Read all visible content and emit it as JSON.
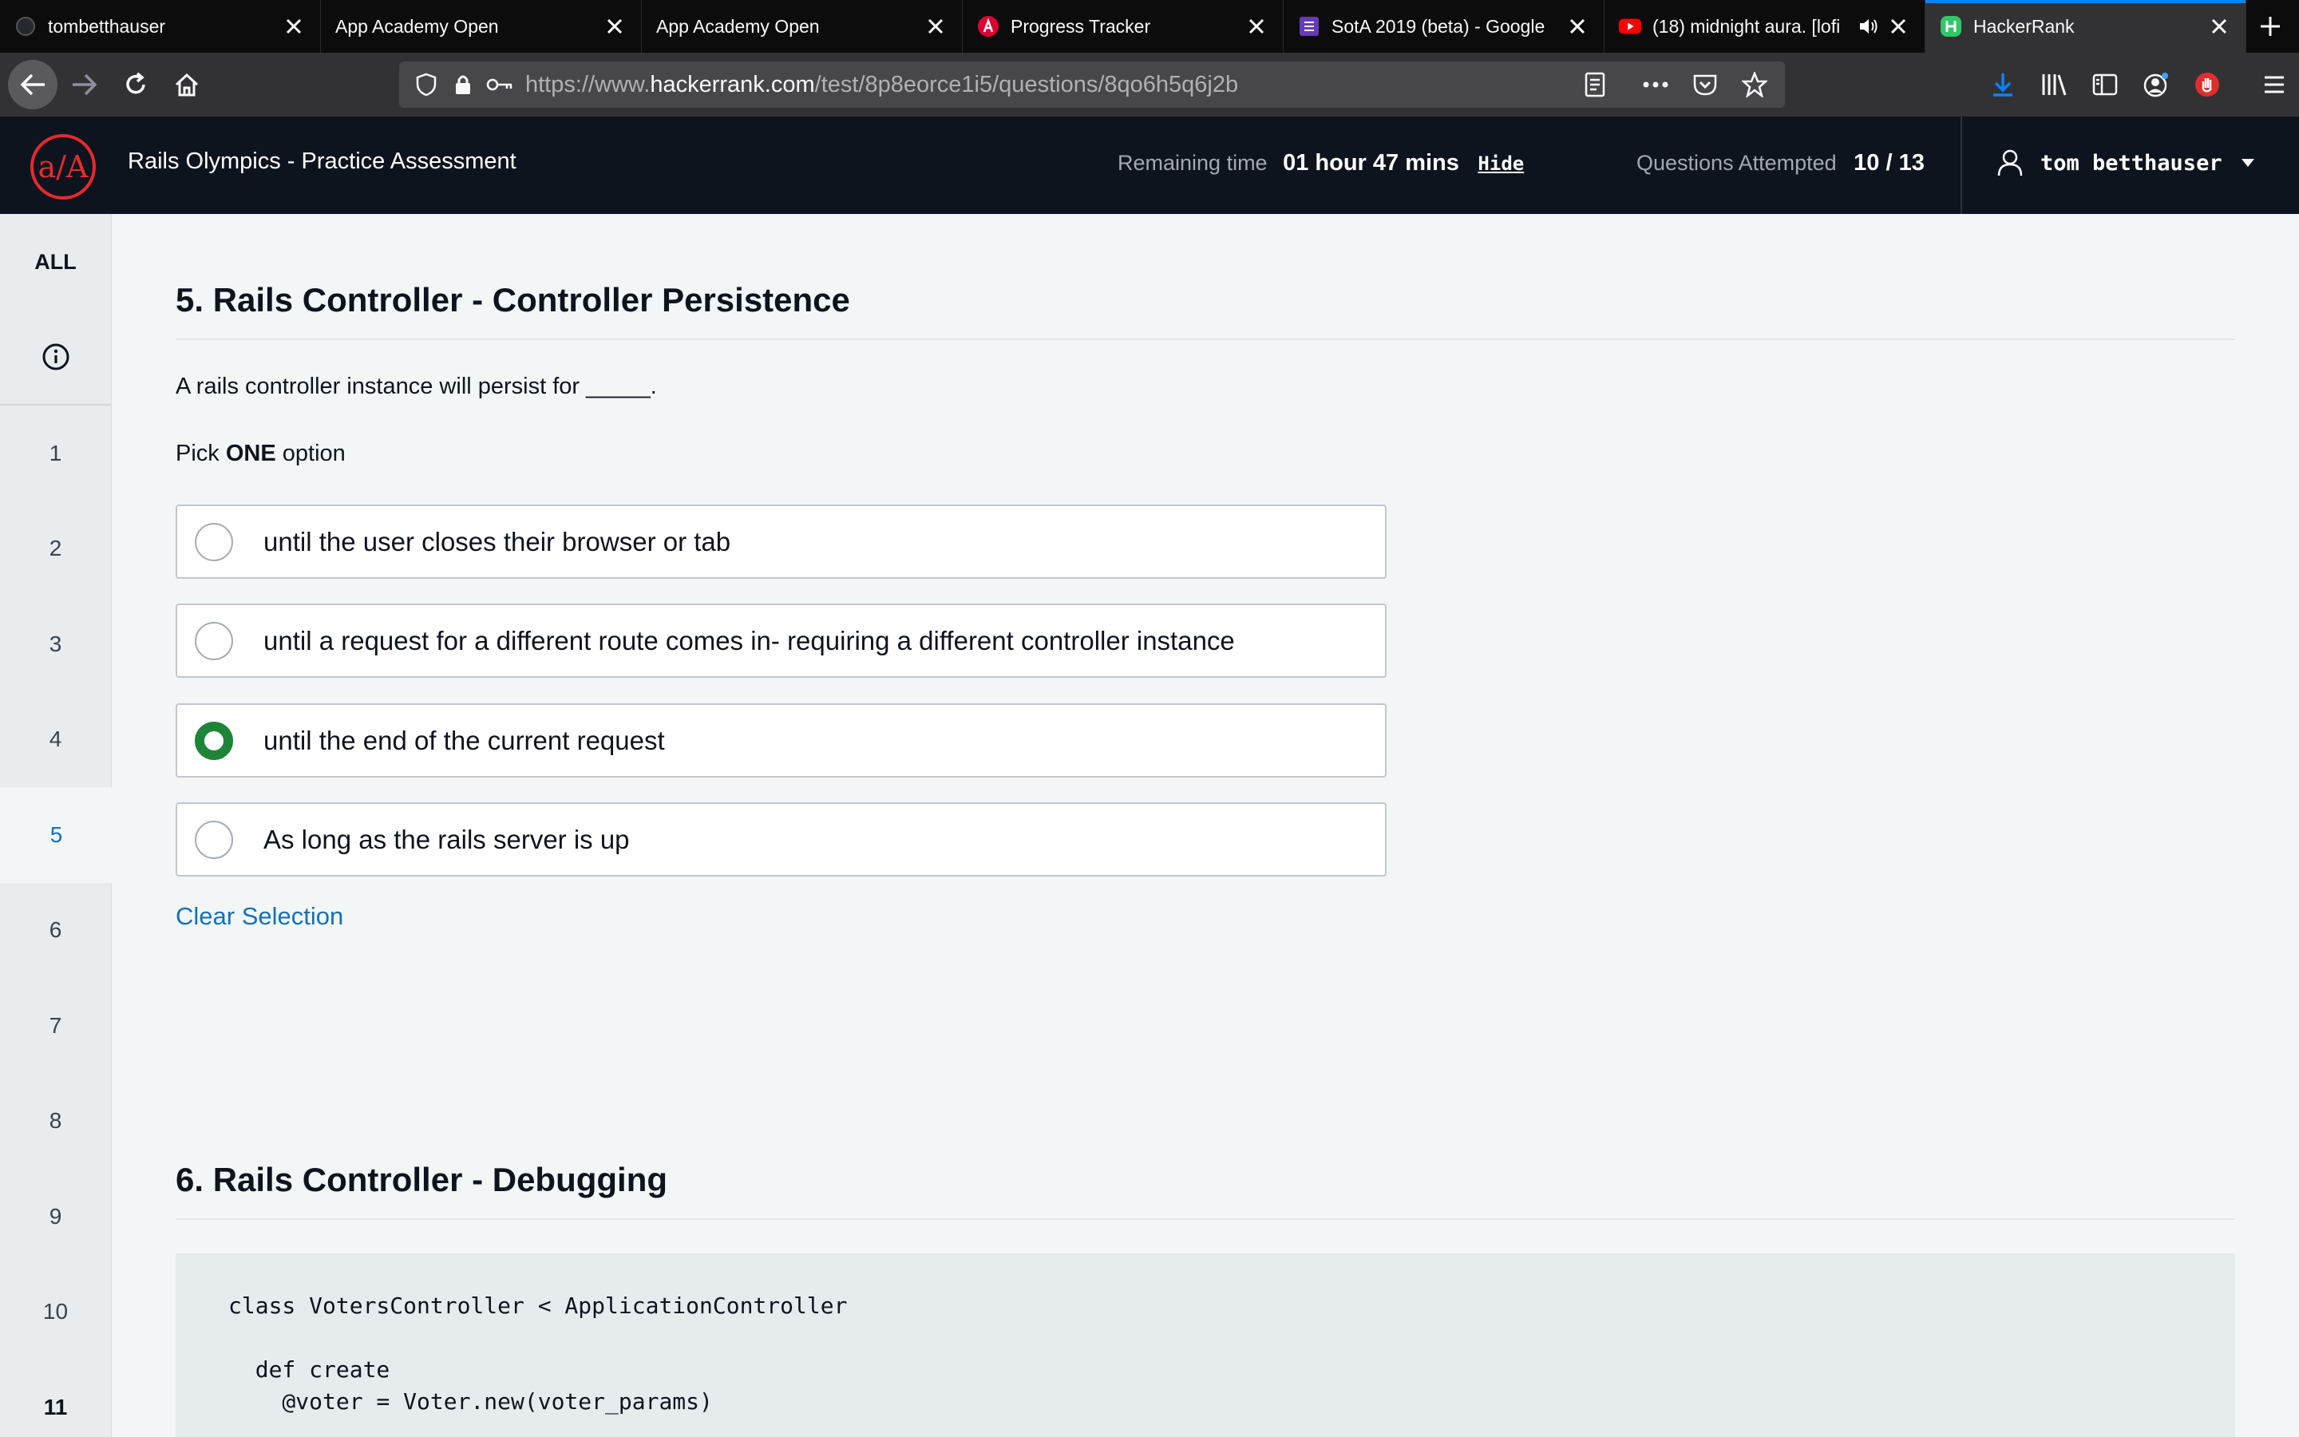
{
  "browser": {
    "tabs": [
      {
        "title": "tombetthauser",
        "icon": "github-icon"
      },
      {
        "title": "App Academy Open",
        "icon": "none"
      },
      {
        "title": "App Academy Open",
        "icon": "none"
      },
      {
        "title": "Progress Tracker",
        "icon": "angular-icon"
      },
      {
        "title": "SotA 2019 (beta) - Google",
        "icon": "google-forms-icon"
      },
      {
        "title": "(18) midnight aura. [lofi",
        "icon": "youtube-icon"
      },
      {
        "title": "HackerRank",
        "icon": "hackerrank-icon"
      }
    ],
    "url_prefix": "https://www.",
    "url_host": "hackerrank.com",
    "url_path": "/test/8p8eorce1i5/questions/8qo6h5q6j2b"
  },
  "header": {
    "test_name": "Rails Olympics - Practice Assessment",
    "remaining_label": "Remaining time",
    "remaining_value": "01 hour 47 mins",
    "hide_label": "Hide",
    "attempted_label": "Questions Attempted",
    "attempted_value": "10 / 13",
    "user_name": "tom betthauser"
  },
  "sidebar": {
    "all_label": "ALL",
    "items": [
      "1",
      "2",
      "3",
      "4",
      "5",
      "6",
      "7",
      "8",
      "9",
      "10",
      "11"
    ]
  },
  "question5": {
    "title": "5. Rails Controller - Controller Persistence",
    "text": "A rails controller instance will persist for _____.",
    "pick_prefix": "Pick",
    "pick_bold": "ONE",
    "pick_suffix": "option",
    "options": [
      "until the user closes their browser or tab",
      "until a request for a different route comes in- requiring a different controller instance",
      "until the end of the current request",
      "As long as the rails server is up"
    ],
    "selected_index": 2,
    "clear_label": "Clear Selection"
  },
  "question6": {
    "title": "6. Rails Controller - Debugging",
    "code": "class VotersController < ApplicationController\n\n  def create\n    @voter = Voter.new(voter_params)"
  },
  "colors": {
    "header_bg": "#0e141e",
    "selected_radio": "#1e8437",
    "link": "#1571b7",
    "accent_red": "#e8292e"
  }
}
